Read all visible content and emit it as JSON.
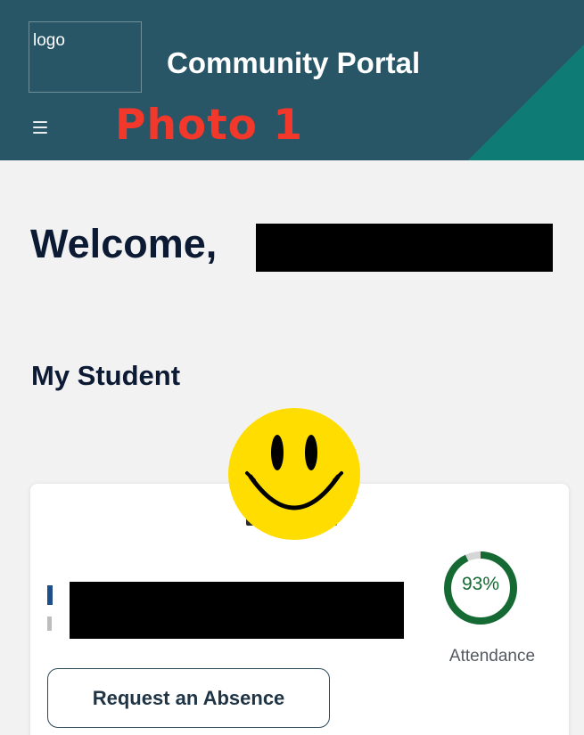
{
  "header": {
    "logo_text": "logo",
    "title": "Community Portal",
    "menu_icon": "hamburger-menu-icon",
    "overlay_label": "Photo 1",
    "colors": {
      "background": "#285667",
      "accent": "#0e7c74",
      "overlay_label": "#f2372b"
    }
  },
  "welcome": {
    "greeting": "Welcome,"
  },
  "my_student": {
    "heading": "My Student",
    "overlay_icon": "smiley-face-icon",
    "attendance": {
      "percent_text": "93%",
      "percent_value": 93,
      "label": "Attendance",
      "color": "#146a32"
    },
    "absence_button_label": "Request an Absence"
  }
}
